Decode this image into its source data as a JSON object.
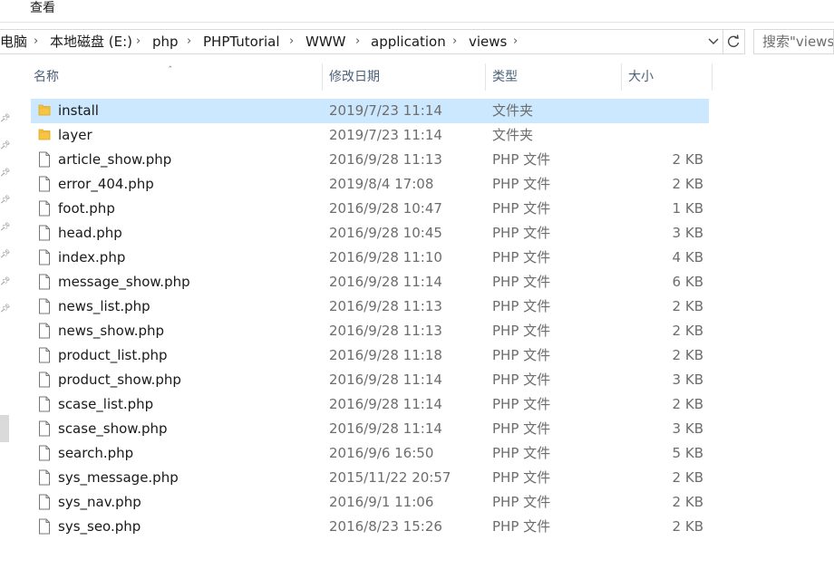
{
  "ribbon": {
    "view_tab": "查看"
  },
  "address": {
    "crumbs": [
      "电脑",
      "本地磁盘 (E:)",
      "php",
      "PHPTutorial",
      "WWW",
      "application",
      "views"
    ]
  },
  "search": {
    "placeholder": "搜索\"views\""
  },
  "columns": {
    "name": "名称",
    "date": "修改日期",
    "type": "类型",
    "size": "大小"
  },
  "icons": {
    "folder": "folder-icon",
    "file": "file-icon",
    "pin": "pin-icon"
  },
  "colors": {
    "selection": "#cce8ff",
    "folder": "#f8c542",
    "header_text": "#4c607a"
  },
  "files": [
    {
      "name": "install",
      "date": "2019/7/23 11:14",
      "type": "文件夹",
      "size": "",
      "kind": "folder",
      "selected": true
    },
    {
      "name": "layer",
      "date": "2019/7/23 11:14",
      "type": "文件夹",
      "size": "",
      "kind": "folder"
    },
    {
      "name": "article_show.php",
      "date": "2016/9/28 11:13",
      "type": "PHP 文件",
      "size": "2 KB",
      "kind": "file"
    },
    {
      "name": "error_404.php",
      "date": "2019/8/4 17:08",
      "type": "PHP 文件",
      "size": "2 KB",
      "kind": "file"
    },
    {
      "name": "foot.php",
      "date": "2016/9/28 10:47",
      "type": "PHP 文件",
      "size": "1 KB",
      "kind": "file"
    },
    {
      "name": "head.php",
      "date": "2016/9/28 10:45",
      "type": "PHP 文件",
      "size": "3 KB",
      "kind": "file"
    },
    {
      "name": "index.php",
      "date": "2016/9/28 11:10",
      "type": "PHP 文件",
      "size": "4 KB",
      "kind": "file"
    },
    {
      "name": "message_show.php",
      "date": "2016/9/28 11:14",
      "type": "PHP 文件",
      "size": "6 KB",
      "kind": "file"
    },
    {
      "name": "news_list.php",
      "date": "2016/9/28 11:13",
      "type": "PHP 文件",
      "size": "2 KB",
      "kind": "file"
    },
    {
      "name": "news_show.php",
      "date": "2016/9/28 11:13",
      "type": "PHP 文件",
      "size": "2 KB",
      "kind": "file"
    },
    {
      "name": "product_list.php",
      "date": "2016/9/28 11:18",
      "type": "PHP 文件",
      "size": "2 KB",
      "kind": "file"
    },
    {
      "name": "product_show.php",
      "date": "2016/9/28 11:14",
      "type": "PHP 文件",
      "size": "3 KB",
      "kind": "file"
    },
    {
      "name": "scase_list.php",
      "date": "2016/9/28 11:14",
      "type": "PHP 文件",
      "size": "2 KB",
      "kind": "file"
    },
    {
      "name": "scase_show.php",
      "date": "2016/9/28 11:14",
      "type": "PHP 文件",
      "size": "3 KB",
      "kind": "file"
    },
    {
      "name": "search.php",
      "date": "2016/9/6 16:50",
      "type": "PHP 文件",
      "size": "5 KB",
      "kind": "file"
    },
    {
      "name": "sys_message.php",
      "date": "2015/11/22 20:57",
      "type": "PHP 文件",
      "size": "2 KB",
      "kind": "file"
    },
    {
      "name": "sys_nav.php",
      "date": "2016/9/1 11:06",
      "type": "PHP 文件",
      "size": "2 KB",
      "kind": "file"
    },
    {
      "name": "sys_seo.php",
      "date": "2016/8/23 15:26",
      "type": "PHP 文件",
      "size": "2 KB",
      "kind": "file"
    }
  ]
}
